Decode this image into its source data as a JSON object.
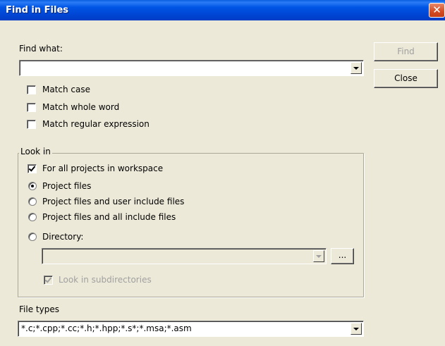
{
  "window": {
    "title": "Find in Files",
    "close_glyph": "✕"
  },
  "find": {
    "label": "Find what:",
    "value": ""
  },
  "options": {
    "match_case": {
      "label": "Match case",
      "checked": false
    },
    "match_whole_word": {
      "label": "Match whole word",
      "checked": false
    },
    "match_regex": {
      "label": "Match regular expression",
      "checked": false
    }
  },
  "look_in": {
    "legend": "Look in",
    "all_projects": {
      "label": "For all projects in workspace",
      "checked": true
    },
    "radios": [
      {
        "label": "Project files",
        "selected": true
      },
      {
        "label": "Project files and user include files",
        "selected": false
      },
      {
        "label": "Project files and all include files",
        "selected": false
      },
      {
        "label": "Directory:",
        "selected": false
      }
    ],
    "directory_value": "",
    "browse_label": "...",
    "subdirs": {
      "label": "Look in subdirectories",
      "checked": true,
      "enabled": false
    }
  },
  "file_types": {
    "label": "File types",
    "value": "*.c;*.cpp;*.cc;*.h;*.hpp;*.s*;*.msa;*.asm"
  },
  "buttons": {
    "find": "Find",
    "close": "Close"
  }
}
